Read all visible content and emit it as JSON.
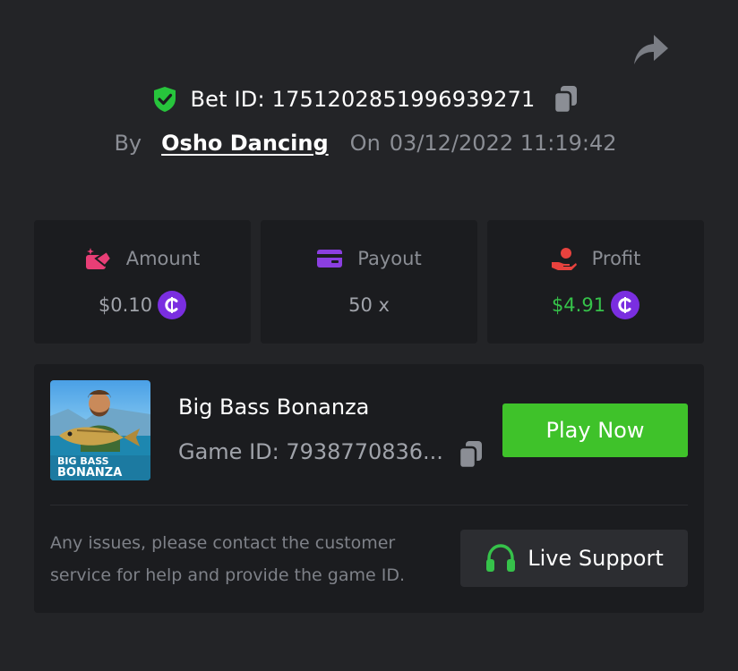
{
  "header": {
    "bet_id": "Bet ID: 1751202851996939271",
    "by_label": "By",
    "username": "Osho Dancing",
    "on_label": "On",
    "datetime": "03/12/2022 11:19:42"
  },
  "stats": [
    {
      "label": "Amount",
      "value": "$0.10",
      "icon": "amount-icon",
      "coin": "₵"
    },
    {
      "label": "Payout",
      "value": "50 x",
      "icon": "card-icon"
    },
    {
      "label": "Profit",
      "value": "$4.91",
      "icon": "profit-hand-icon",
      "coin": "₵"
    }
  ],
  "game": {
    "name": "Big Bass Bonanza",
    "game_id": "Game ID: 7938770836...",
    "play_label": "Play Now",
    "thumb_line1": "BIG BASS",
    "thumb_line2": "BONANZA"
  },
  "support": {
    "help_text": "Any issues, please contact the customer service for help and provide the game ID.",
    "button_label": "Live Support"
  },
  "colors": {
    "background": "#232427",
    "card": "#1b1c1f",
    "accent_green": "#3fc22a",
    "profit_green": "#36c24a",
    "coin_purple": "#7a2ee0",
    "amount_pink": "#e83e76",
    "payout_purple": "#8b3fe0",
    "profit_red": "#e8423e"
  }
}
